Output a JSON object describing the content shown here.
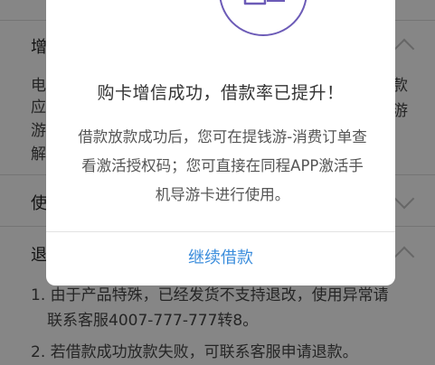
{
  "background": {
    "section1": {
      "title": "增",
      "line1_left": "电",
      "line1_right": "款",
      "line2_left": "应",
      "line2_right": "",
      "line3_left": "游",
      "line3_right": "游",
      "line4_left": "解"
    },
    "section2": {
      "title": "使"
    },
    "section3": {
      "title": "退",
      "item1_line1": "1. 由于产品特殊，已经发货不支持退改，使用异常请",
      "item1_line2": "联系客服4007-777-777转8。",
      "item2": "2. 若借款成功放款失败，可联系客服申请退款。"
    }
  },
  "dialog": {
    "title": "购卡增信成功，借款率已提升！",
    "message": "借款放款成功后，您可在提钱游-消费订单查看激活授权码；您可直接在同程APP激活手机导游卡进行使用。",
    "button_label": "继续借款",
    "accent_color": "#6c5bb7",
    "button_color": "#3b8ddc",
    "icon": "document-stamp-icon"
  }
}
